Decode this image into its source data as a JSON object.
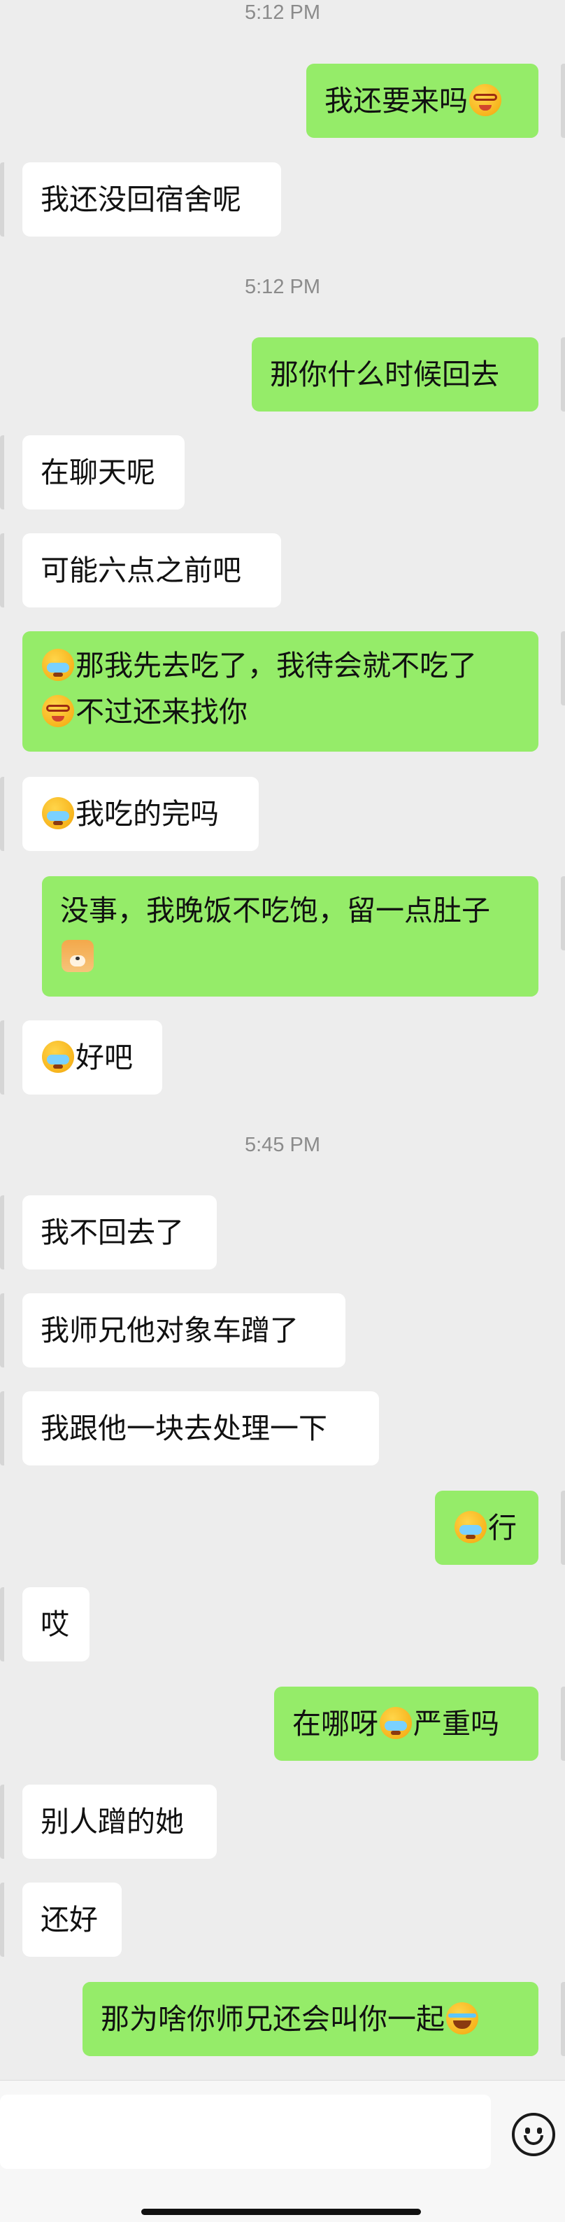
{
  "timestamps": [
    "5:12 PM",
    "5:12 PM",
    "5:45 PM"
  ],
  "messages": [
    {
      "side": "out",
      "text": "我还要来吗",
      "emoji_after": "glasses-face-icon"
    },
    {
      "side": "in",
      "text": "我还没回宿舍呢"
    },
    {
      "side": "out",
      "text": "那你什么时候回去"
    },
    {
      "side": "in",
      "text": "在聊天呢"
    },
    {
      "side": "in",
      "text": "可能六点之前吧"
    },
    {
      "side": "out",
      "line1": "那我先去吃了，我待会就不吃了",
      "line2": "不过还来找你",
      "emoji1": "crying-face-icon",
      "emoji2": "glasses-face-icon"
    },
    {
      "side": "in",
      "text": "我吃的完吗",
      "emoji_before": "crying-face-icon"
    },
    {
      "side": "out",
      "line1": "没事，我晚饭不吃饱，留一点肚子",
      "emoji2": "shiba-dog-icon"
    },
    {
      "side": "in",
      "text": "好吧",
      "emoji_before": "crying-face-icon"
    },
    {
      "side": "in",
      "text": "我不回去了"
    },
    {
      "side": "in",
      "text": "我师兄他对象车蹭了"
    },
    {
      "side": "in",
      "text": "我跟他一块去处理一下"
    },
    {
      "side": "out",
      "text": "行",
      "emoji_before": "crying-face-icon"
    },
    {
      "side": "in",
      "text": "哎"
    },
    {
      "side": "out",
      "text_a": "在哪呀",
      "text_b": "严重吗",
      "emoji_mid": "crying-face-icon"
    },
    {
      "side": "in",
      "text": "别人蹭的她"
    },
    {
      "side": "in",
      "text": "还好"
    },
    {
      "side": "out",
      "text": "那为啥你师兄还会叫你一起",
      "emoji_after": "laughing-tears-icon"
    }
  ],
  "input": {
    "placeholder": "",
    "emoji_button": "smiley-icon"
  }
}
